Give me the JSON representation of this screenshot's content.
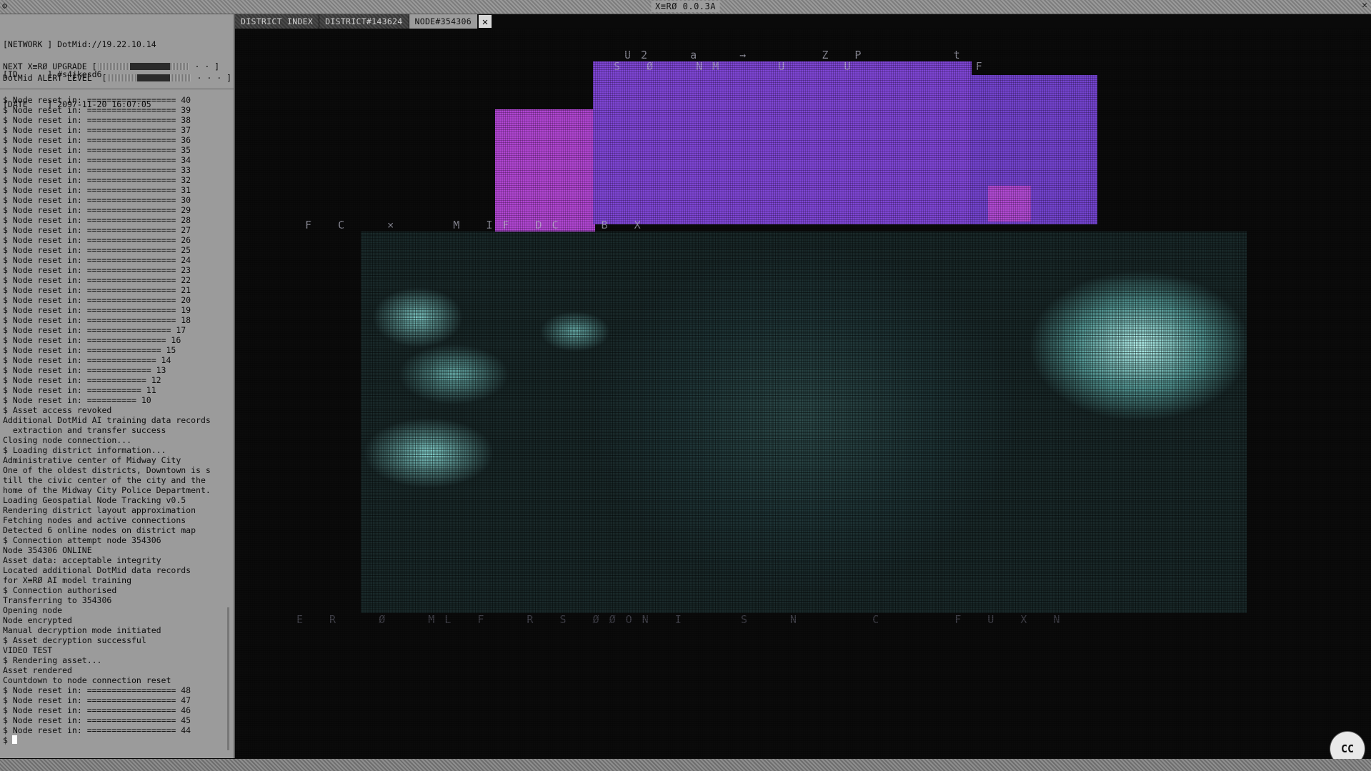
{
  "window": {
    "title": "X≡RØ 0.0.3A",
    "close_glyph": "✕",
    "menu_glyph": "⚙"
  },
  "header": {
    "lines": [
      "[NETWORK ] DotMid://19.22.10.14",
      "[ID      ] #s4jkesd6",
      "[DATE    ] 2097-11-20 16:07:05"
    ]
  },
  "meters": [
    {
      "label": "NEXT X≡RØ UPGRADE [",
      "value": 0.8,
      "tail": " · · ]"
    },
    {
      "label": "DotMid ALERT LEVEL  [",
      "value": 0.75,
      "tail": " · · · ]"
    }
  ],
  "log": [
    "$ Node reset in: ================== 40",
    "$ Node reset in: ================== 39",
    "$ Node reset in: ================== 38",
    "$ Node reset in: ================== 37",
    "$ Node reset in: ================== 36",
    "$ Node reset in: ================== 35",
    "$ Node reset in: ================== 34",
    "$ Node reset in: ================== 33",
    "$ Node reset in: ================== 32",
    "$ Node reset in: ================== 31",
    "$ Node reset in: ================== 30",
    "$ Node reset in: ================== 29",
    "$ Node reset in: ================== 28",
    "$ Node reset in: ================== 27",
    "$ Node reset in: ================== 26",
    "$ Node reset in: ================== 25",
    "$ Node reset in: ================== 24",
    "$ Node reset in: ================== 23",
    "$ Node reset in: ================== 22",
    "$ Node reset in: ================== 21",
    "$ Node reset in: ================== 20",
    "$ Node reset in: ================== 19",
    "$ Node reset in: ================== 18",
    "$ Node reset in: ================= 17",
    "$ Node reset in: ================ 16",
    "$ Node reset in: =============== 15",
    "$ Node reset in: ============== 14",
    "$ Node reset in: ============= 13",
    "$ Node reset in: ============ 12",
    "$ Node reset in: =========== 11",
    "$ Node reset in: ========== 10",
    "$ Asset access revoked",
    "Additional DotMid AI training data records",
    "  extraction and transfer success",
    "Closing node connection...",
    "$ Loading district information...",
    "Administrative center of Midway City",
    "One of the oldest districts, Downtown is s",
    "till the civic center of the city and the",
    "home of the Midway City Police Department.",
    "Loading Geospatial Node Tracking v0.5",
    "Rendering district layout approximation",
    "Fetching nodes and active connections",
    "Detected 6 online nodes on district map",
    "$ Connection attempt node 354306",
    "Node 354306 ONLINE",
    "Asset data: acceptable integrity",
    "Located additional DotMid data records",
    "for X≡RØ AI model training",
    "$ Connection authorised",
    "Transferring to 354306",
    "Opening node",
    "Node encrypted",
    "Manual decryption mode initiated",
    "$ Asset decryption successful",
    "VIDEO TEST",
    "$ Rendering asset...",
    "Asset rendered",
    "Countdown to node connection reset",
    "$ Node reset in: ================== 48",
    "$ Node reset in: ================== 47",
    "$ Node reset in: ================== 46",
    "$ Node reset in: ================== 45",
    "$ Node reset in: ================== 44"
  ],
  "prompt": "$",
  "tabs": [
    {
      "label": "DISTRICT INDEX",
      "active": false
    },
    {
      "label": "DISTRICT#143624",
      "active": false
    },
    {
      "label": "NODE#354306",
      "active": true
    }
  ],
  "tab_close": "✕",
  "glyph_rows": [
    "U2  a  →    Z P     t",
    "S Ø  NM   U   U       F",
    "F C  ×   M IF DC  B X",
    "E R  Ø  ML F  R S ØØON I   S  N    C    F U X N"
  ],
  "cc_button": "CC",
  "colors": {
    "panel": "#9b9b9b",
    "magenta": "#b146d3",
    "violet": "#7f46d6",
    "cyan": "#bffffa"
  }
}
